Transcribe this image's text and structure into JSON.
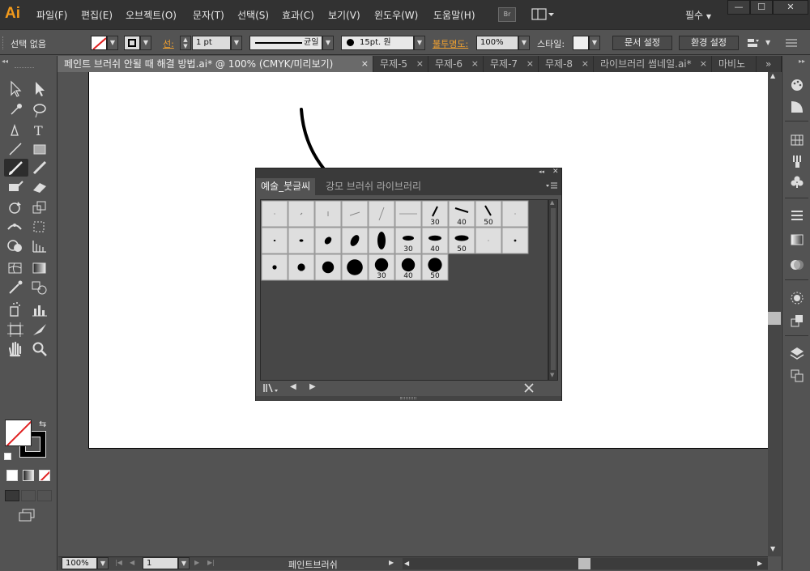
{
  "app": {
    "logo": "Ai",
    "workspace": "필수"
  },
  "menu": [
    "파일(F)",
    "편집(E)",
    "오브젝트(O)",
    "문자(T)",
    "선택(S)",
    "효과(C)",
    "보기(V)",
    "윈도우(W)",
    "도움말(H)"
  ],
  "bridge_label": "Br",
  "window_controls": {
    "minimize": "—",
    "maximize": "☐",
    "close": "✕"
  },
  "control": {
    "selection_status": "선택 없음",
    "stroke_label": "선:",
    "stroke_weight": "1 pt",
    "profile_label": "균일",
    "brush_label": "15pt. 원",
    "opacity_label": "불투명도:",
    "opacity_value": "100%",
    "style_label": "스타일:",
    "doc_setup_button": "문서 설정",
    "prefs_button": "환경 설정"
  },
  "tabs": [
    {
      "label": "페인트 브러쉬 안될 때 해결 방법.ai* @ 100% (CMYK/미리보기)",
      "close": "×",
      "active": true
    },
    {
      "label": "무제-5",
      "close": "×",
      "active": false
    },
    {
      "label": "무제-6",
      "close": "×",
      "active": false
    },
    {
      "label": "무제-7",
      "close": "×",
      "active": false
    },
    {
      "label": "무제-8",
      "close": "×",
      "active": false
    },
    {
      "label": "라이브러리 썸네일.ai*",
      "close": "×",
      "active": false
    },
    {
      "label": "마비노",
      "close": "",
      "active": false
    }
  ],
  "tab_overflow": "»",
  "status": {
    "zoom": "100%",
    "page": "1",
    "tool_name": "페인트브러쉬"
  },
  "brush_panel": {
    "tabs": [
      "예술_붓글씨",
      "강모 브러쉬 라이브러리"
    ],
    "rows": [
      [
        {
          "label": ""
        },
        {
          "label": ""
        },
        {
          "label": ""
        },
        {
          "label": ""
        },
        {
          "label": ""
        },
        {
          "label": ""
        },
        {
          "label": "30"
        },
        {
          "label": "40"
        },
        {
          "label": "50"
        },
        {
          "label": ""
        }
      ],
      [
        {
          "label": ""
        },
        {
          "label": ""
        },
        {
          "label": ""
        },
        {
          "label": ""
        },
        {
          "label": ""
        },
        {
          "label": "30"
        },
        {
          "label": "40"
        },
        {
          "label": "50"
        },
        {
          "label": ""
        },
        {
          "label": ""
        }
      ],
      [
        {
          "label": ""
        },
        {
          "label": ""
        },
        {
          "label": ""
        },
        {
          "label": ""
        },
        {
          "label": "30"
        },
        {
          "label": "40"
        },
        {
          "label": "50"
        }
      ]
    ]
  },
  "colors": {
    "accent_orange": "#f29a1c",
    "panel_bg": "#535353",
    "menu_bg": "#323232"
  }
}
